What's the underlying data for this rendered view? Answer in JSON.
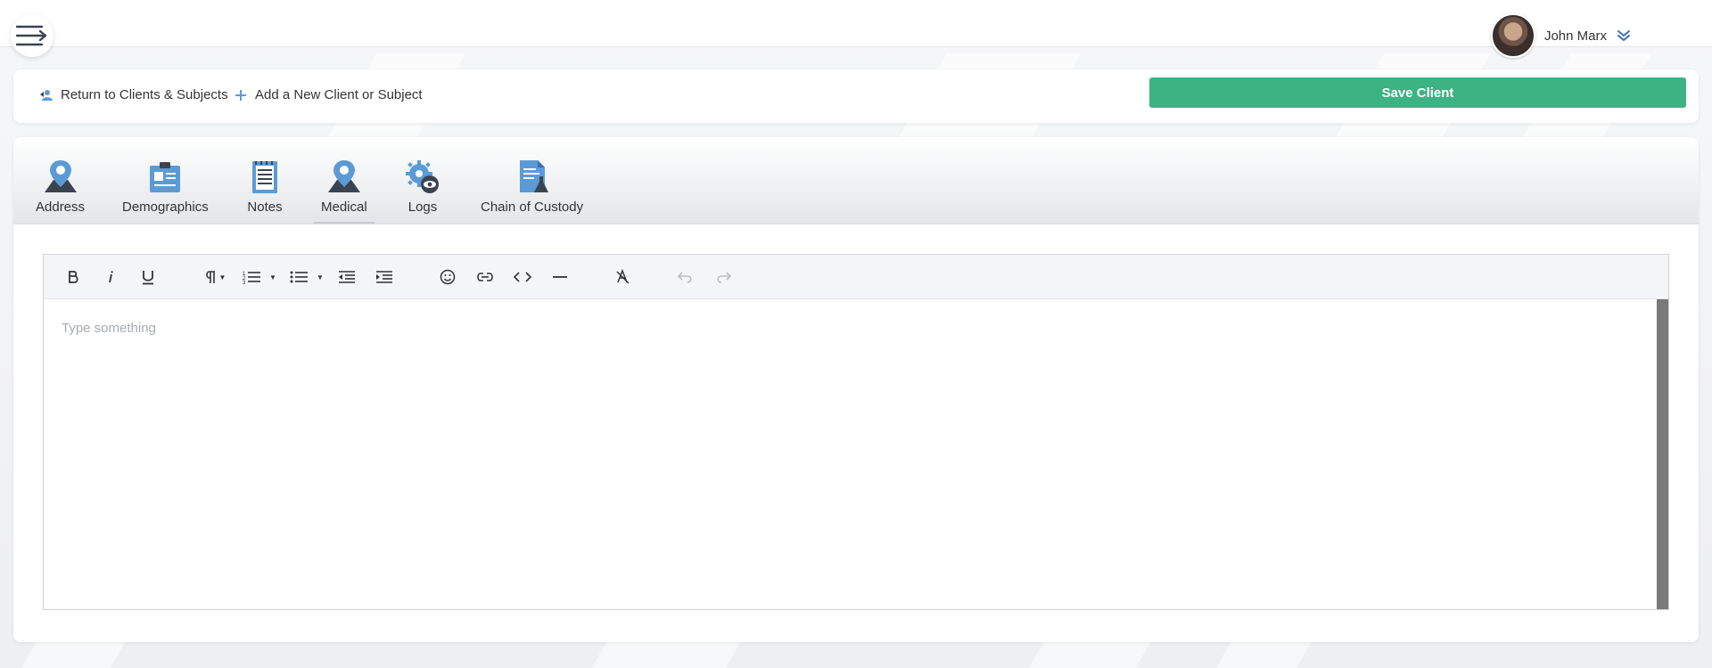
{
  "header": {
    "menu_icon": "menu-arrow-icon",
    "user_name": "John Marx",
    "user_chevron_icon": "double-chevron-down-icon"
  },
  "actions": {
    "return_label": "Return to Clients & Subjects",
    "return_icon": "users-return-icon",
    "add_label": "Add a New Client or Subject",
    "add_icon": "plus-icon",
    "save_label": "Save Client",
    "save_color": "#3db283"
  },
  "tabs": [
    {
      "label": "Address",
      "icon": "map-pin-icon"
    },
    {
      "label": "Demographics",
      "icon": "clipboard-id-icon"
    },
    {
      "label": "Notes",
      "icon": "notepad-icon"
    },
    {
      "label": "Medical",
      "icon": "map-pin-icon",
      "active": true
    },
    {
      "label": "Logs",
      "icon": "gear-eye-icon"
    },
    {
      "label": "Chain of Custody",
      "icon": "document-flask-icon"
    }
  ],
  "editor": {
    "placeholder": "Type something",
    "toolbar": [
      "bold",
      "italic",
      "underline",
      "paragraph",
      "ordered-list",
      "unordered-list",
      "outdent",
      "indent",
      "emoji",
      "link",
      "code",
      "horizontal-rule",
      "clear-format",
      "undo",
      "redo"
    ]
  },
  "colors": {
    "icon_blue": "#5b9bd5",
    "icon_dark": "#3b4350",
    "accent_green": "#3db283"
  }
}
